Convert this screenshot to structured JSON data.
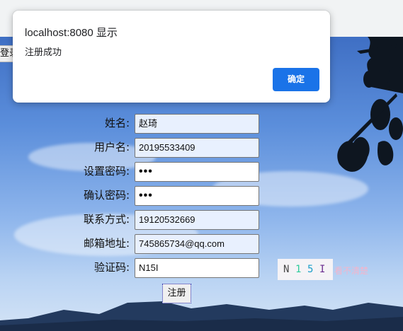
{
  "dialog": {
    "title": "localhost:8080 显示",
    "message": "注册成功",
    "ok_label": "确定"
  },
  "login_tab": {
    "label": "登录"
  },
  "form": {
    "fields": [
      {
        "label": "姓名:",
        "value": "赵琦"
      },
      {
        "label": "用户名:",
        "value": "20195533409"
      },
      {
        "label": "设置密码:",
        "value": "•••"
      },
      {
        "label": "确认密码:",
        "value": "•••"
      },
      {
        "label": "联系方式:",
        "value": "19120532669"
      },
      {
        "label": "邮箱地址:",
        "value": "745865734@qq.com"
      },
      {
        "label": "验证码:",
        "value": "N15I"
      }
    ],
    "captcha": {
      "chars": [
        "N",
        "1",
        "5",
        "I"
      ],
      "colors": [
        "#4a4a4a",
        "#2ecc9a",
        "#1a9ec9",
        "#6a2d8f"
      ],
      "hint": "看不清楚"
    },
    "submit_label": "注册"
  },
  "colors": {
    "accent": "#1a73e8",
    "autofill_bg": "#e8f0fe"
  }
}
